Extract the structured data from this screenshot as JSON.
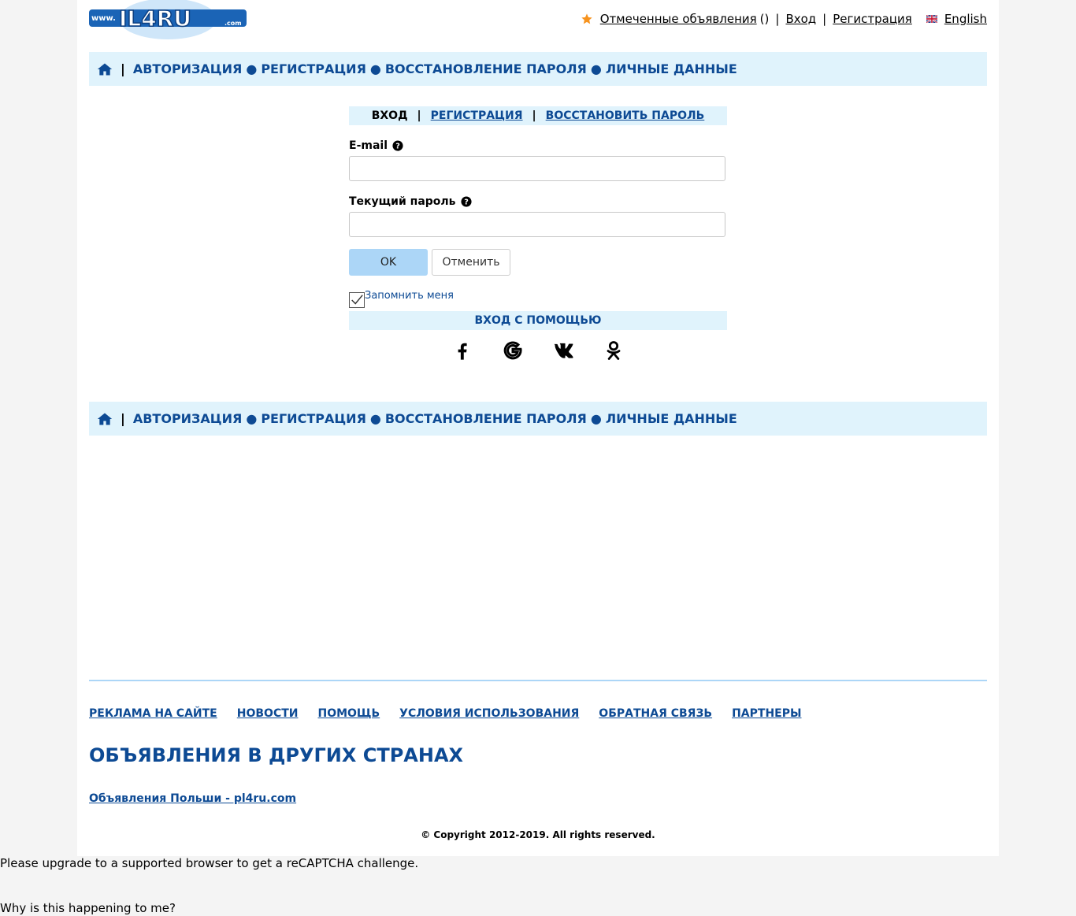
{
  "header": {
    "logo_prefix": "www.",
    "logo_main": "IL4RU",
    "logo_suffix": ".com",
    "favorites_label": "Отмеченные объявления",
    "favorites_count": "()",
    "login_label": "Вход",
    "register_label": "Регистрация",
    "language_label": "English"
  },
  "nav": {
    "items": [
      "АВТОРИЗАЦИЯ",
      "РЕГИСТРАЦИЯ",
      "ВОССТАНОВЛЕНИЕ ПАРОЛЯ",
      "ЛИЧНЫЕ ДАННЫЕ"
    ]
  },
  "auth": {
    "tabs": [
      "ВХОД",
      "РЕГИСТРАЦИЯ",
      "ВОССТАНОВИТЬ ПАРОЛЬ"
    ],
    "email_label": "E-mail",
    "email_value": "",
    "password_label": "Текущий пароль",
    "password_value": "",
    "ok_label": "OK",
    "cancel_label": "Отменить",
    "remember_label": "Запомнить меня",
    "remember_checked": true,
    "social_title": "ВХОД С ПОМОЩЬЮ",
    "social_icons": [
      "facebook-icon",
      "google-icon",
      "vk-icon",
      "odnoklassniki-icon"
    ]
  },
  "footer": {
    "links": [
      "РЕКЛАМА НА САЙТЕ",
      "НОВОСТИ",
      "ПОМОЩЬ",
      "УСЛОВИЯ ИСПОЛЬЗОВАНИЯ",
      "ОБРАТНАЯ СВЯЗЬ",
      "ПАРТНЕРЫ"
    ],
    "countries_title": "ОБЪЯВЛЕНИЯ В ДРУГИХ СТРАНАХ",
    "country_link": "Объявления Польши - pl4ru.com",
    "copyright": "© Copyright 2012-2019. All rights reserved."
  },
  "recaptcha": {
    "message": "Please upgrade to a supported browser to get a reCAPTCHA challenge.",
    "why": "Why is this happening to me?"
  },
  "colors": {
    "brand_blue": "#0d4a94",
    "nav_bg": "#e0f3fc",
    "button_ok": "#acd6f7",
    "star": "#f7931e"
  }
}
